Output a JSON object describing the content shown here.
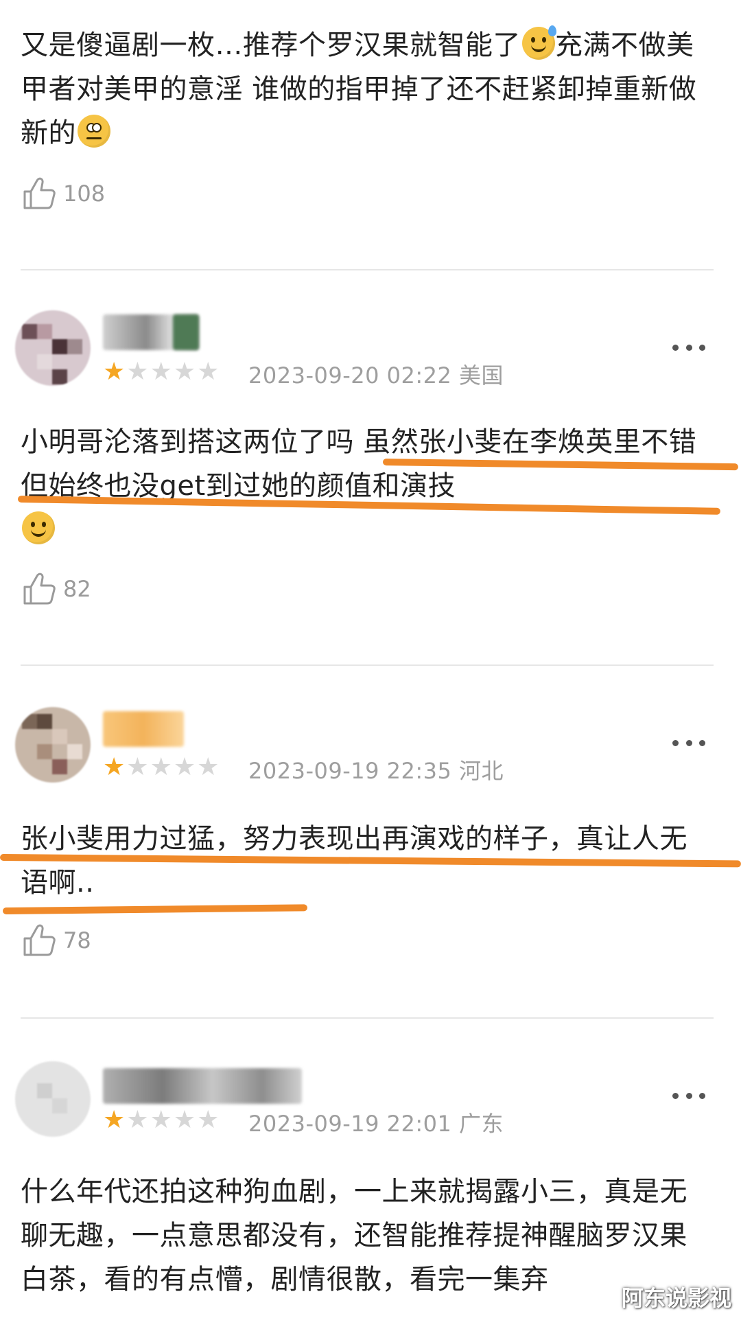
{
  "comments": [
    {
      "text_parts": [
        "又是傻逼剧一枚…推荐个罗汉果就智能了",
        "充满不做美甲者对美甲的意淫 谁做的指甲掉了还不赶紧卸掉重新做新的"
      ],
      "likes": "108"
    },
    {
      "rating": 1,
      "date": "2023-09-20 02:22",
      "region": "美国",
      "text": "小明哥沦落到搭这两位了吗 虽然张小斐在李焕英里不错 但始终也没get到过她的颜值和演技",
      "likes": "82"
    },
    {
      "rating": 1,
      "date": "2023-09-19 22:35",
      "region": "河北",
      "text": "张小斐用力过猛，努力表现出再演戏的样子，真让人无语啊..",
      "likes": "78"
    },
    {
      "rating": 1,
      "date": "2023-09-19 22:01",
      "region": "广东",
      "text": "什么年代还拍这种狗血剧，一上来就揭露小三，真是无聊无趣，一点意思都没有，还智能推荐提神醒脑罗汉果白茶，看的有点懵，剧情很散，看完一集弃"
    }
  ],
  "icons": {
    "like": "thumbs-up-icon",
    "more": "more-dots-icon",
    "emoji_sweat": "grinning-sweat-emoji",
    "emoji_roll": "eye-roll-emoji",
    "emoji_smile": "slight-smile-emoji"
  },
  "colors": {
    "accent_underline": "#f08a2a",
    "star_on": "#f5a623",
    "star_off": "#d7d7d7"
  },
  "watermark": "阿东说影视"
}
